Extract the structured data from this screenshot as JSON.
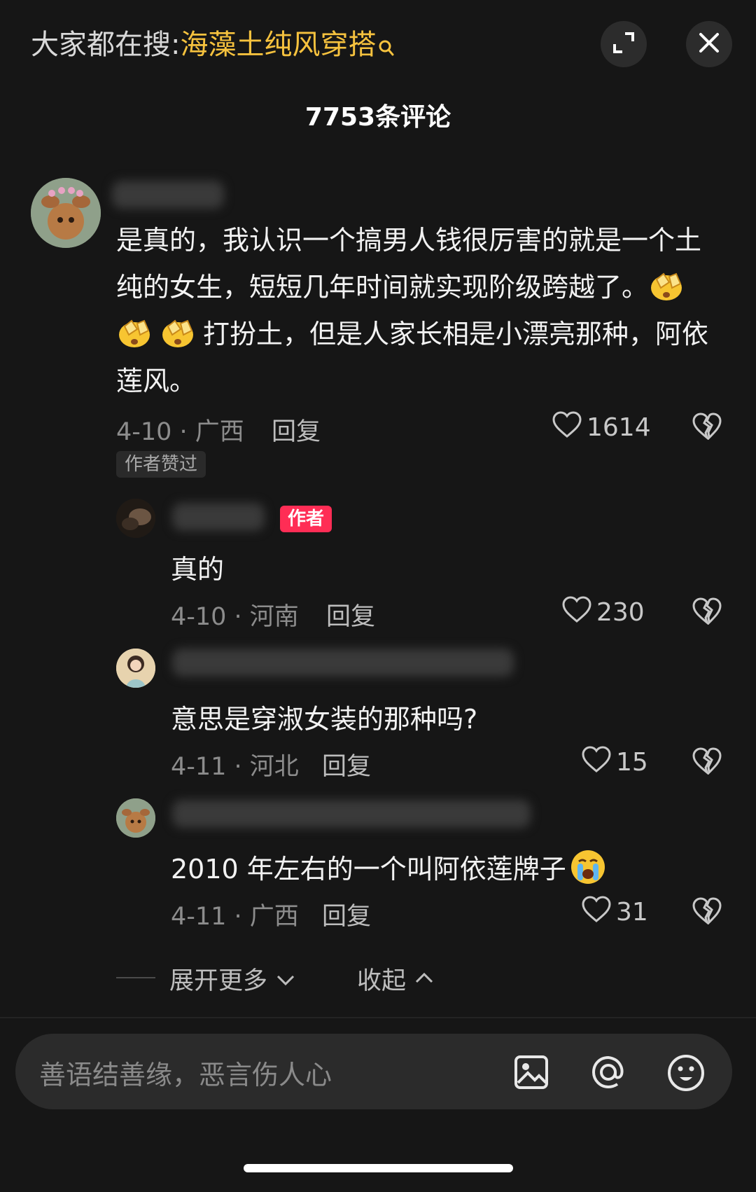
{
  "header": {
    "search_prefix": "大家都在搜:",
    "search_term": "海藻土纯风穿搭",
    "comment_count_title": "7753条评论"
  },
  "comments": {
    "main": {
      "text_before_emoji": "是真的，我认识一个搞男人钱很厉害的就是一个土纯的女生，短短几年时间就实现阶级跨越了。",
      "text_after_emoji": "打扮土，但是人家长相是小漂亮那种，阿依莲风。",
      "date_location": "4-10 · 广西",
      "reply_label": "回复",
      "likes": "1614",
      "author_liked_tag": "作者赞过"
    },
    "replies": [
      {
        "author_badge": "作者",
        "text": "真的",
        "date_location": "4-10 · 河南",
        "reply_label": "回复",
        "likes": "230"
      },
      {
        "text": "意思是穿淑女装的那种吗?",
        "date_location": "4-11 · 河北",
        "reply_label": "回复",
        "likes": "15"
      },
      {
        "text": "2010 年左右的一个叫阿依莲牌子",
        "date_location": "4-11 · 广西",
        "reply_label": "回复",
        "likes": "31"
      }
    ],
    "expand_more": "展开更多",
    "collapse": "收起"
  },
  "input": {
    "placeholder": "善语结善缘，恶言伤人心"
  },
  "colors": {
    "background": "#161616",
    "search_term": "#f6c23e",
    "author_badge": "#ff2d55"
  },
  "icons": [
    "search-icon",
    "expand-icon",
    "close-icon",
    "heart-icon",
    "broken-heart-icon",
    "image-icon",
    "at-icon",
    "smile-icon",
    "chevron-down-icon",
    "chevron-up-icon",
    "clapping-emoji",
    "crying-emoji"
  ]
}
